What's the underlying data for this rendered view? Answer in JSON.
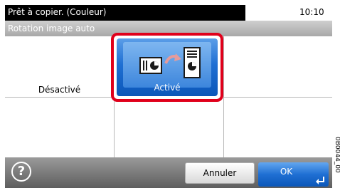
{
  "status": {
    "message": "Prêt à copier. (Couleur)",
    "clock": "10:10"
  },
  "function": {
    "title": "Rotation image auto"
  },
  "options": [
    {
      "label": "Désactivé",
      "selected": false
    },
    {
      "label": "Activé",
      "selected": true
    }
  ],
  "footer": {
    "help_label": "?",
    "cancel_label": "Annuler",
    "ok_label": "OK"
  },
  "doc_code": "0B0044_00",
  "colors": {
    "selection_frame": "#e0001b",
    "selected_button": "#1f6fd3"
  },
  "icons": [
    "auto-rotate-icon",
    "help-icon",
    "enter-icon"
  ]
}
